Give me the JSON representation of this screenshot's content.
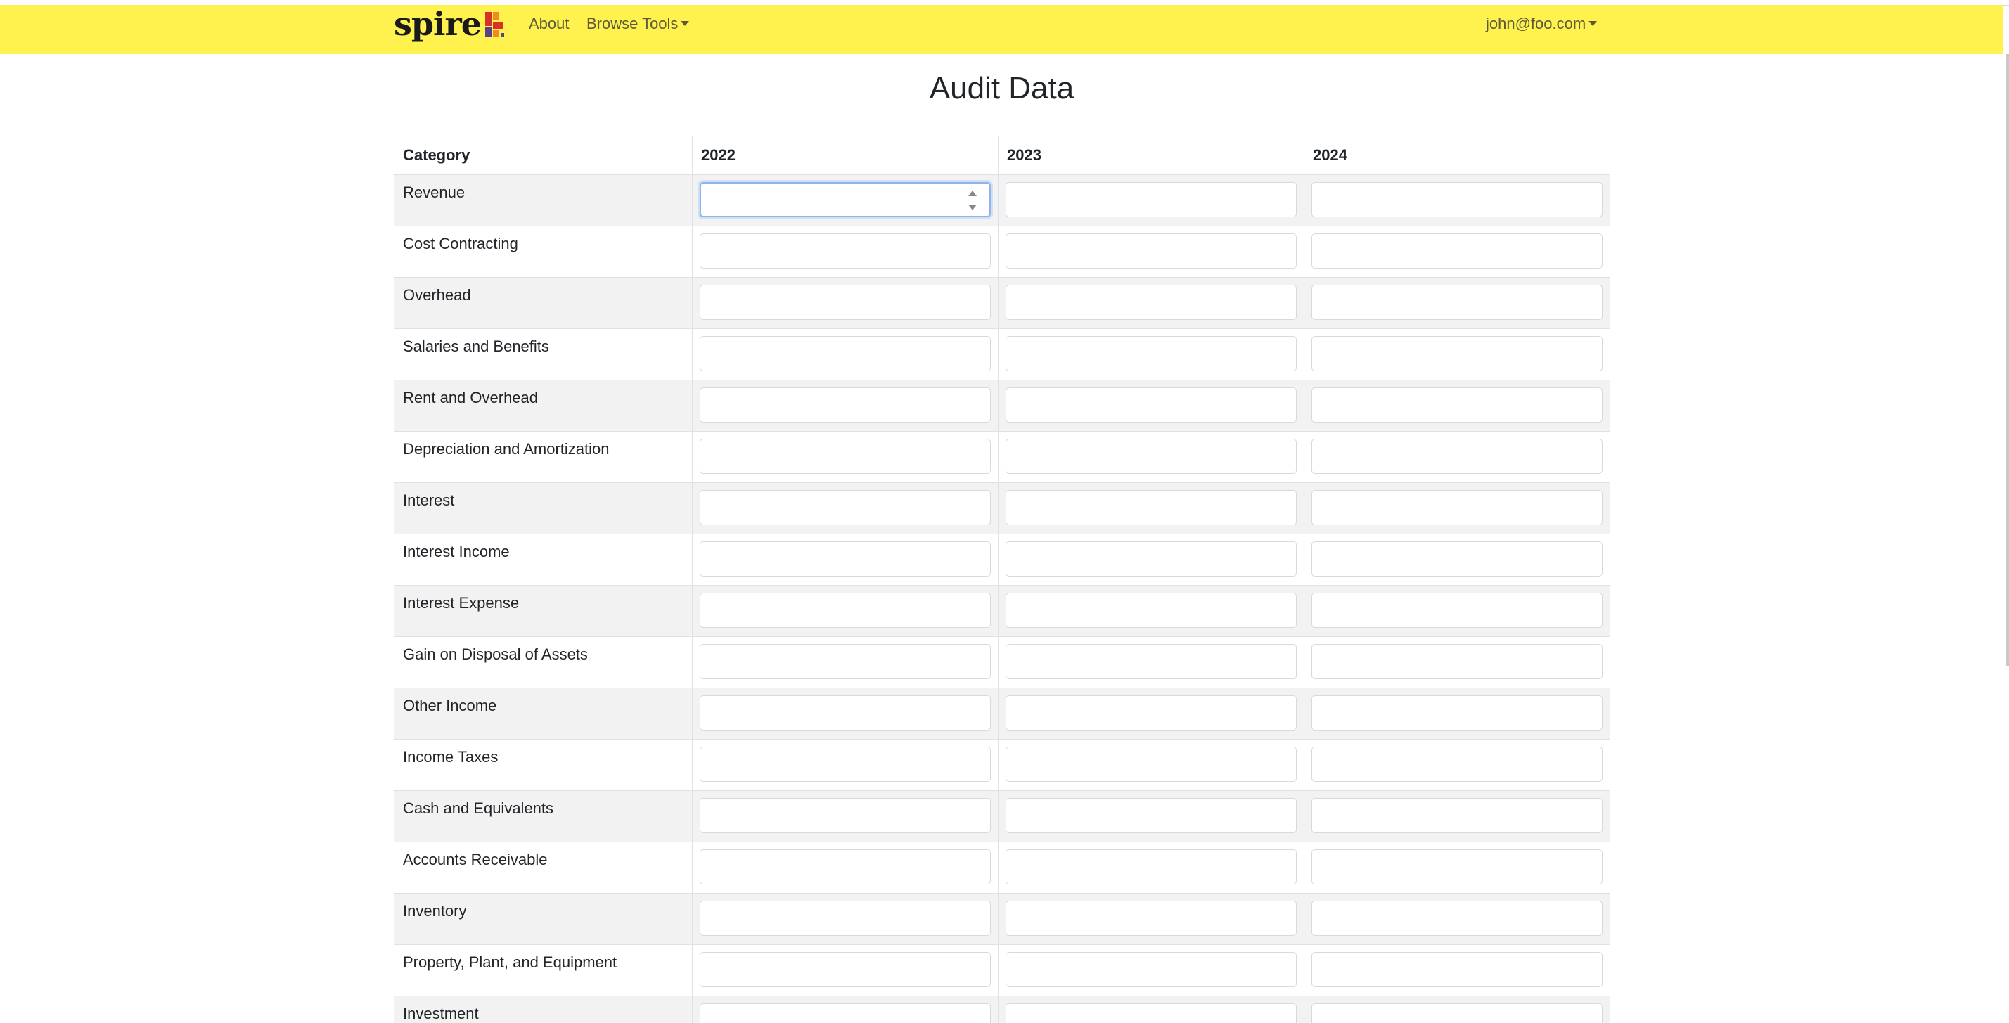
{
  "navbar": {
    "brand": "spire",
    "links": [
      {
        "label": "About"
      },
      {
        "label": "Browse Tools"
      }
    ],
    "user": "john@foo.com",
    "colors": {
      "background": "#fff24f",
      "logo_red": "#d9302a",
      "logo_orange": "#f08a24",
      "logo_purple": "#5a3f8c"
    }
  },
  "page": {
    "title": "Audit Data"
  },
  "table": {
    "headers": [
      "Category",
      "2022",
      "2023",
      "2024"
    ],
    "rows": [
      {
        "category": "Revenue"
      },
      {
        "category": "Cost Contracting"
      },
      {
        "category": "Overhead"
      },
      {
        "category": "Salaries and Benefits"
      },
      {
        "category": "Rent and Overhead"
      },
      {
        "category": "Depreciation and Amortization"
      },
      {
        "category": "Interest"
      },
      {
        "category": "Interest Income"
      },
      {
        "category": "Interest Expense"
      },
      {
        "category": "Gain on Disposal of Assets"
      },
      {
        "category": "Other Income"
      },
      {
        "category": "Income Taxes"
      },
      {
        "category": "Cash and Equivalents"
      },
      {
        "category": "Accounts Receivable"
      },
      {
        "category": "Inventory"
      },
      {
        "category": "Property, Plant, and Equipment"
      },
      {
        "category": "Investment"
      }
    ],
    "focused_cell": {
      "row": 0,
      "column": "2022"
    }
  }
}
